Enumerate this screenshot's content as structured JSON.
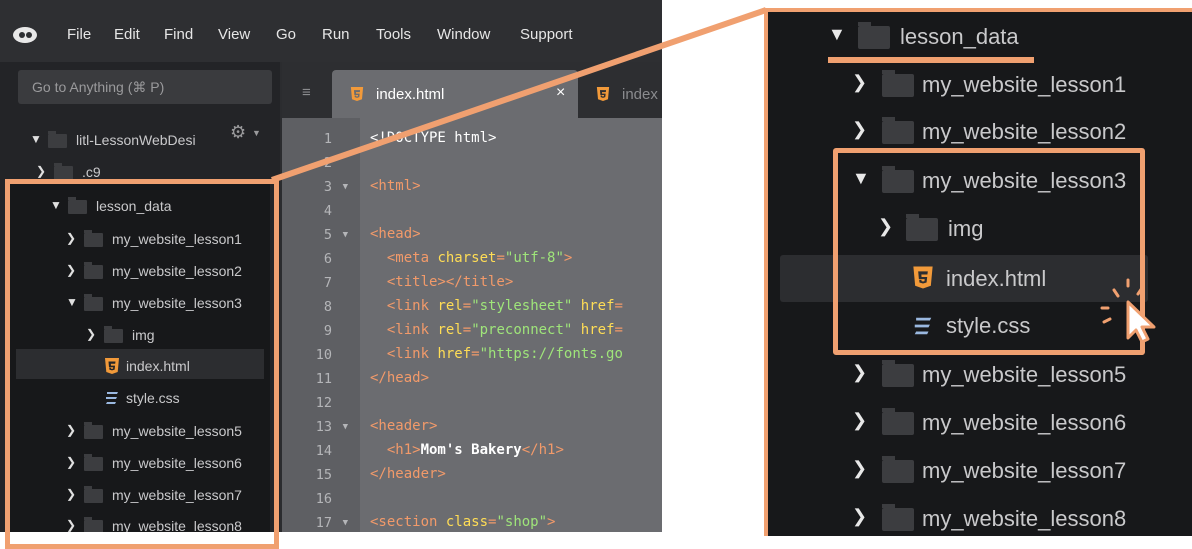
{
  "menubar": {
    "items": [
      "File",
      "Edit",
      "Find",
      "View",
      "Go",
      "Run",
      "Tools",
      "Window",
      "Support"
    ]
  },
  "search": {
    "placeholder": "Go to Anything (⌘ P)"
  },
  "sidebar": {
    "workspace": "litl-LessonWebDesi",
    "items": [
      {
        "label": ".c9"
      },
      {
        "label": "lesson_data"
      },
      {
        "label": "my_website_lesson1"
      },
      {
        "label": "my_website_lesson2"
      },
      {
        "label": "my_website_lesson3"
      },
      {
        "label": "img"
      },
      {
        "label": "index.html"
      },
      {
        "label": "style.css"
      },
      {
        "label": "my_website_lesson5"
      },
      {
        "label": "my_website_lesson6"
      },
      {
        "label": "my_website_lesson7"
      },
      {
        "label": "my_website_lesson8"
      }
    ]
  },
  "editor": {
    "tabs": [
      {
        "label": "index.html"
      },
      {
        "label": "index"
      }
    ],
    "line_numbers": [
      "1",
      "2",
      "3",
      "4",
      "5",
      "6",
      "7",
      "8",
      "9",
      "10",
      "11",
      "12",
      "13",
      "14",
      "15",
      "16",
      "17"
    ]
  },
  "zoom": {
    "items": [
      {
        "label": "lesson_data"
      },
      {
        "label": "my_website_lesson1"
      },
      {
        "label": "my_website_lesson2"
      },
      {
        "label": "my_website_lesson3"
      },
      {
        "label": "img"
      },
      {
        "label": "index.html"
      },
      {
        "label": "style.css"
      },
      {
        "label": "my_website_lesson5"
      },
      {
        "label": "my_website_lesson6"
      },
      {
        "label": "my_website_lesson7"
      },
      {
        "label": "my_website_lesson8"
      }
    ]
  },
  "colors": {
    "highlight": "#f0a070",
    "html_icon": "#f29a3a",
    "css_icon": "#9ab8e0"
  }
}
